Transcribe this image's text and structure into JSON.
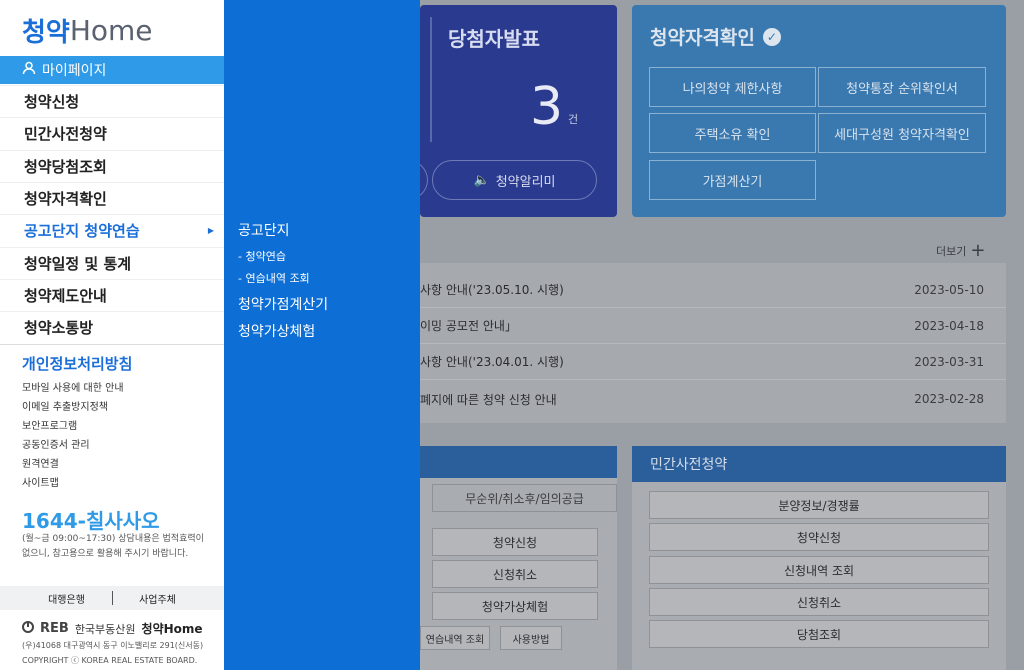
{
  "logo": {
    "part1": "청약",
    "part2": "Home"
  },
  "sidebar": {
    "mypage": "마이페이지",
    "items": [
      {
        "label": "청약신청"
      },
      {
        "label": "민간사전청약"
      },
      {
        "label": "청약당첨조회"
      },
      {
        "label": "청약자격확인"
      },
      {
        "label": "공고단지 청약연습",
        "active": true
      },
      {
        "label": "청약일정 및 통계"
      },
      {
        "label": "청약제도안내"
      },
      {
        "label": "청약소통방"
      }
    ],
    "privacy_title": "개인정보처리방침",
    "links": [
      "모바일 사용에 대한 안내",
      "이메일 추출방지정책",
      "보안프로그램",
      "공동인증서 관리",
      "원격연결",
      "사이트맵"
    ],
    "phone": "1644-칠사사오",
    "phone_note": "(월~금 09:00~17:30) 상담내용은 법적효력이 없으니, 참고용으로 활용해 주시기 바랍니다.",
    "bank_button": "대행은행",
    "operator_button": "사업주체",
    "footer_org": "한국부동산원",
    "footer_brand": "청약Home",
    "footer_reb": "REB",
    "address": "(우)41068 대구광역시 동구 이노밸리로 291(신서동)",
    "copyright": "COPYRIGHT ⓒ KOREA REAL ESTATE BOARD."
  },
  "submenu": {
    "title1": "공고단지",
    "sub1": "- 청약연습",
    "sub2": "- 연습내역 조회",
    "title2": "청약가점계산기",
    "title3": "청약가상체험"
  },
  "winners_card": {
    "title": "당첨자발표",
    "count": "3",
    "unit": "건",
    "alert_button": "청약알리미"
  },
  "qualification_card": {
    "title": "청약자격확인",
    "buttons": [
      "나의청약 제한사항",
      "청약통장 순위확인서",
      "주택소유 확인",
      "세대구성원 청약자격확인",
      "가점계산기"
    ]
  },
  "notices": {
    "more": "더보기",
    "rows": [
      {
        "title": "사항 안내('23.05.10. 시행)",
        "date": "2023-05-10"
      },
      {
        "title": "이밍 공모전 안내」",
        "date": "2023-04-18"
      },
      {
        "title": "사항 안내('23.04.01. 시행)",
        "date": "2023-03-31"
      },
      {
        "title": "폐지에 따른 청약 신청 안내",
        "date": "2023-02-28"
      }
    ]
  },
  "left_panel": {
    "tab": "무순위/취소후/임의공급",
    "buttons": [
      "청약신청",
      "신청취소",
      "청약가상체험"
    ],
    "small_buttons": [
      "연습내역 조회",
      "사용방법"
    ]
  },
  "right_panel": {
    "title": "민간사전청약",
    "buttons": [
      "분양정보/경쟁률",
      "청약신청",
      "신청내역 조회",
      "신청취소",
      "당첨조회"
    ]
  }
}
